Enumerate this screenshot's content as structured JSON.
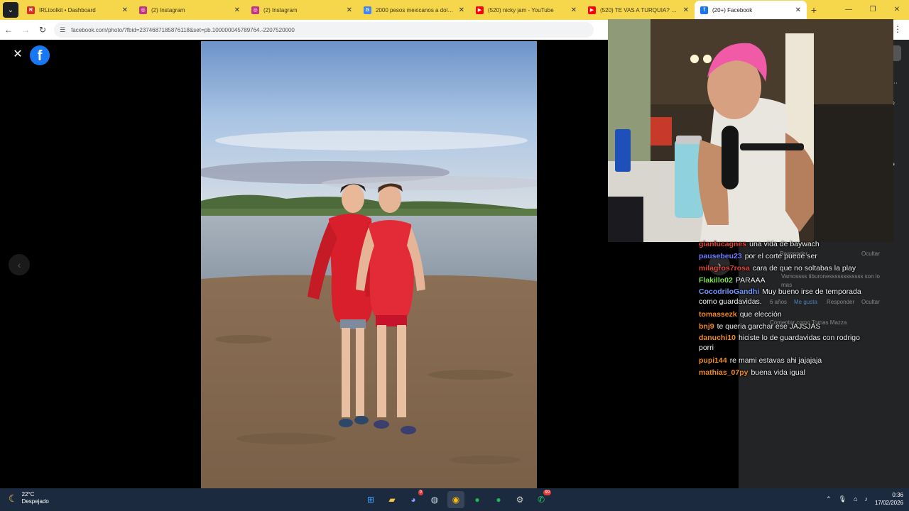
{
  "browser": {
    "tabs": [
      {
        "title": "IRLtoolkit • Dashboard",
        "icon": "irltoolkit-icon",
        "color": "#d93025",
        "glyph": "R"
      },
      {
        "title": "(2) Instagram",
        "icon": "instagram-icon",
        "color": "#c13584",
        "glyph": "◎"
      },
      {
        "title": "(2) Instagram",
        "icon": "instagram-icon",
        "color": "#c13584",
        "glyph": "◎"
      },
      {
        "title": "2000 pesos mexicanos a dolares",
        "icon": "google-icon",
        "color": "#4285f4",
        "glyph": "G"
      },
      {
        "title": "(520) nicky jam - YouTube",
        "icon": "youtube-icon",
        "color": "#ff0000",
        "glyph": "▶"
      },
      {
        "title": "(520) TE VAS A TURQUIA? - YouTube",
        "icon": "youtube-icon",
        "color": "#ff0000",
        "glyph": "▶"
      },
      {
        "title": "(20+) Facebook",
        "icon": "facebook-icon",
        "color": "#1877f2",
        "glyph": "f",
        "active": true
      }
    ],
    "url": "facebook.com/photo/?fbid=2374687185876118&set=pb.100000045789764.-2207520000"
  },
  "viewer": {
    "logo_glyph": "f"
  },
  "chat": [
    {
      "user": "gianlucagnes",
      "text": "una vida de baywach",
      "color": "#e0453a"
    },
    {
      "user": "pausebeu23",
      "text": "por el corte puede ser",
      "color": "#6f7cff"
    },
    {
      "user": "milagros7rosa",
      "text": "cara de que no soltabas la play",
      "color": "#e0453a"
    },
    {
      "user": "Flakillo02",
      "text": "PARAAA",
      "color": "#7ee24f"
    },
    {
      "user": "CocodriloGandhi",
      "text": "Muy bueno irse de temporada como guardavidas.",
      "color": "#6f95ff"
    },
    {
      "user": "tomassezk",
      "text": "que elección",
      "color": "#f08a24"
    },
    {
      "user": "bnj9",
      "text": "te queria garchar ese JAJSJAS",
      "color": "#f08a24"
    },
    {
      "user": "danuchi10",
      "text": "hiciste lo de guardavidas con rodrigo porri",
      "color": "#f08a24"
    },
    {
      "user": "pupi144",
      "text": "re mami estavas ahi jajajaja",
      "color": "#f08a24"
    },
    {
      "user": "mathias_07py",
      "text": "buena vida igual",
      "color": "#f08a24"
    }
  ],
  "fb_comments": {
    "reply": "Responder",
    "hide": "Ocultar",
    "like": "Me gusta",
    "time": "6 años",
    "comment_text": "Vamossss tiburonessssssssssss son lo mas",
    "comment_as": "Comentar como Tomas Mazza"
  },
  "taskbar": {
    "temp": "22°C",
    "weather": "Despejado",
    "time": "0:36",
    "date": "17/02/2026"
  }
}
